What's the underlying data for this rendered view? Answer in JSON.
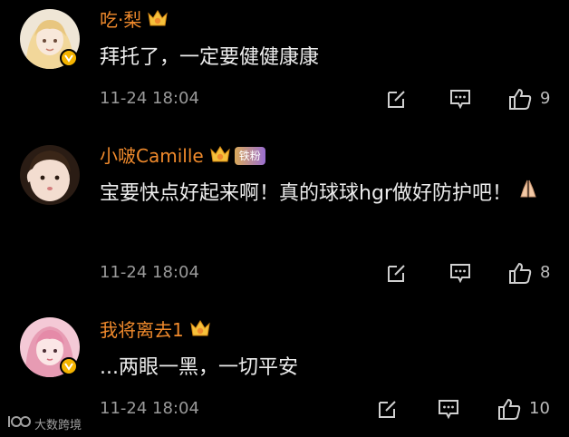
{
  "comments": [
    {
      "username": "吃·梨",
      "text": "拜托了，一定要健健康康",
      "timestamp": "11-24 18:04",
      "likes": "9",
      "icons": [
        "crown-icon",
        "edit-icon",
        "comment-icon",
        "like-icon"
      ]
    },
    {
      "username": "小啵Camille",
      "badge": "铁粉",
      "text": "宝要快点好起来啊！真的球球hgr做好防护吧！",
      "timestamp": "11-24 18:04",
      "likes": "8",
      "icons": [
        "crown-icon",
        "edit-icon",
        "comment-icon",
        "like-icon"
      ]
    },
    {
      "username": "我将离去1",
      "text": "...两眼一黑，一切平安",
      "timestamp": "11-24 18:04",
      "likes": "10",
      "icons": [
        "crown-icon",
        "edit-icon",
        "comment-icon",
        "like-icon"
      ]
    }
  ],
  "watermark": {
    "text": "大数跨境"
  },
  "colors": {
    "background": "#000000",
    "username": "#f08a2c",
    "text": "#ececec",
    "meta": "#9a9a9a",
    "verify": "#f5b400"
  }
}
